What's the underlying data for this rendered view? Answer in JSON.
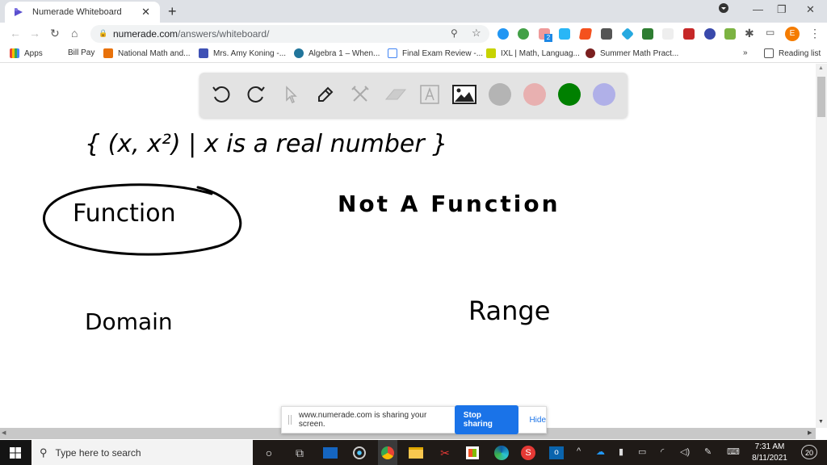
{
  "browser": {
    "tab_title": "Numerade Whiteboard",
    "tab_close": "✕",
    "new_tab": "+",
    "url_domain": "numerade.com",
    "url_path": "/answers/whiteboard/",
    "profile_initial": "E",
    "extension_badge": "2",
    "window_controls": {
      "minimize": "—",
      "restore": "❐",
      "close": "✕"
    }
  },
  "bookmarks": {
    "items": [
      {
        "label": "Apps",
        "icon": "apps-grid-icon",
        "color": "#4285f4"
      },
      {
        "label": "Bill Pay",
        "icon": "",
        "color": ""
      },
      {
        "label": "National Math and...",
        "icon": "x-logo-icon",
        "color": "#e8710a"
      },
      {
        "label": "Mrs. Amy Koning -...",
        "icon": "calendar-icon",
        "color": "#3f51b5"
      },
      {
        "label": "Algebra 1 – When...",
        "icon": "wordpress-icon",
        "color": "#21759b"
      },
      {
        "label": "Final Exam Review -...",
        "icon": "form-icon",
        "color": "#4285f4"
      },
      {
        "label": "IXL | Math, Languag...",
        "icon": "ixl-icon",
        "color": "#c7d300"
      },
      {
        "label": "Summer Math Pract...",
        "icon": "site-icon",
        "color": "#7a1f1f"
      }
    ],
    "overflow": "»",
    "reading_list": "Reading list"
  },
  "whiteboard": {
    "tools": [
      {
        "name": "undo",
        "enabled": true
      },
      {
        "name": "redo",
        "enabled": true
      },
      {
        "name": "select",
        "enabled": false
      },
      {
        "name": "pen",
        "enabled": true
      },
      {
        "name": "tools",
        "enabled": false
      },
      {
        "name": "eraser",
        "enabled": false
      },
      {
        "name": "text",
        "enabled": false
      },
      {
        "name": "image",
        "enabled": true
      }
    ],
    "colors": [
      "#b4b4b4",
      "#e8b0b0",
      "#008000",
      "#b0b0e8"
    ],
    "handwriting": {
      "set_notation": "{ (x, x²) | x is a real number }",
      "function": "Function",
      "not_a_function": "Not A Function",
      "domain": "Domain",
      "range": "Range",
      "circled": "Function"
    }
  },
  "share_banner": {
    "message": "www.numerade.com is sharing your screen.",
    "stop_label": "Stop sharing",
    "hide_label": "Hide"
  },
  "taskbar": {
    "search_placeholder": "Type here to search",
    "time": "7:31 AM",
    "date": "8/11/2021",
    "notification_count": "20"
  }
}
